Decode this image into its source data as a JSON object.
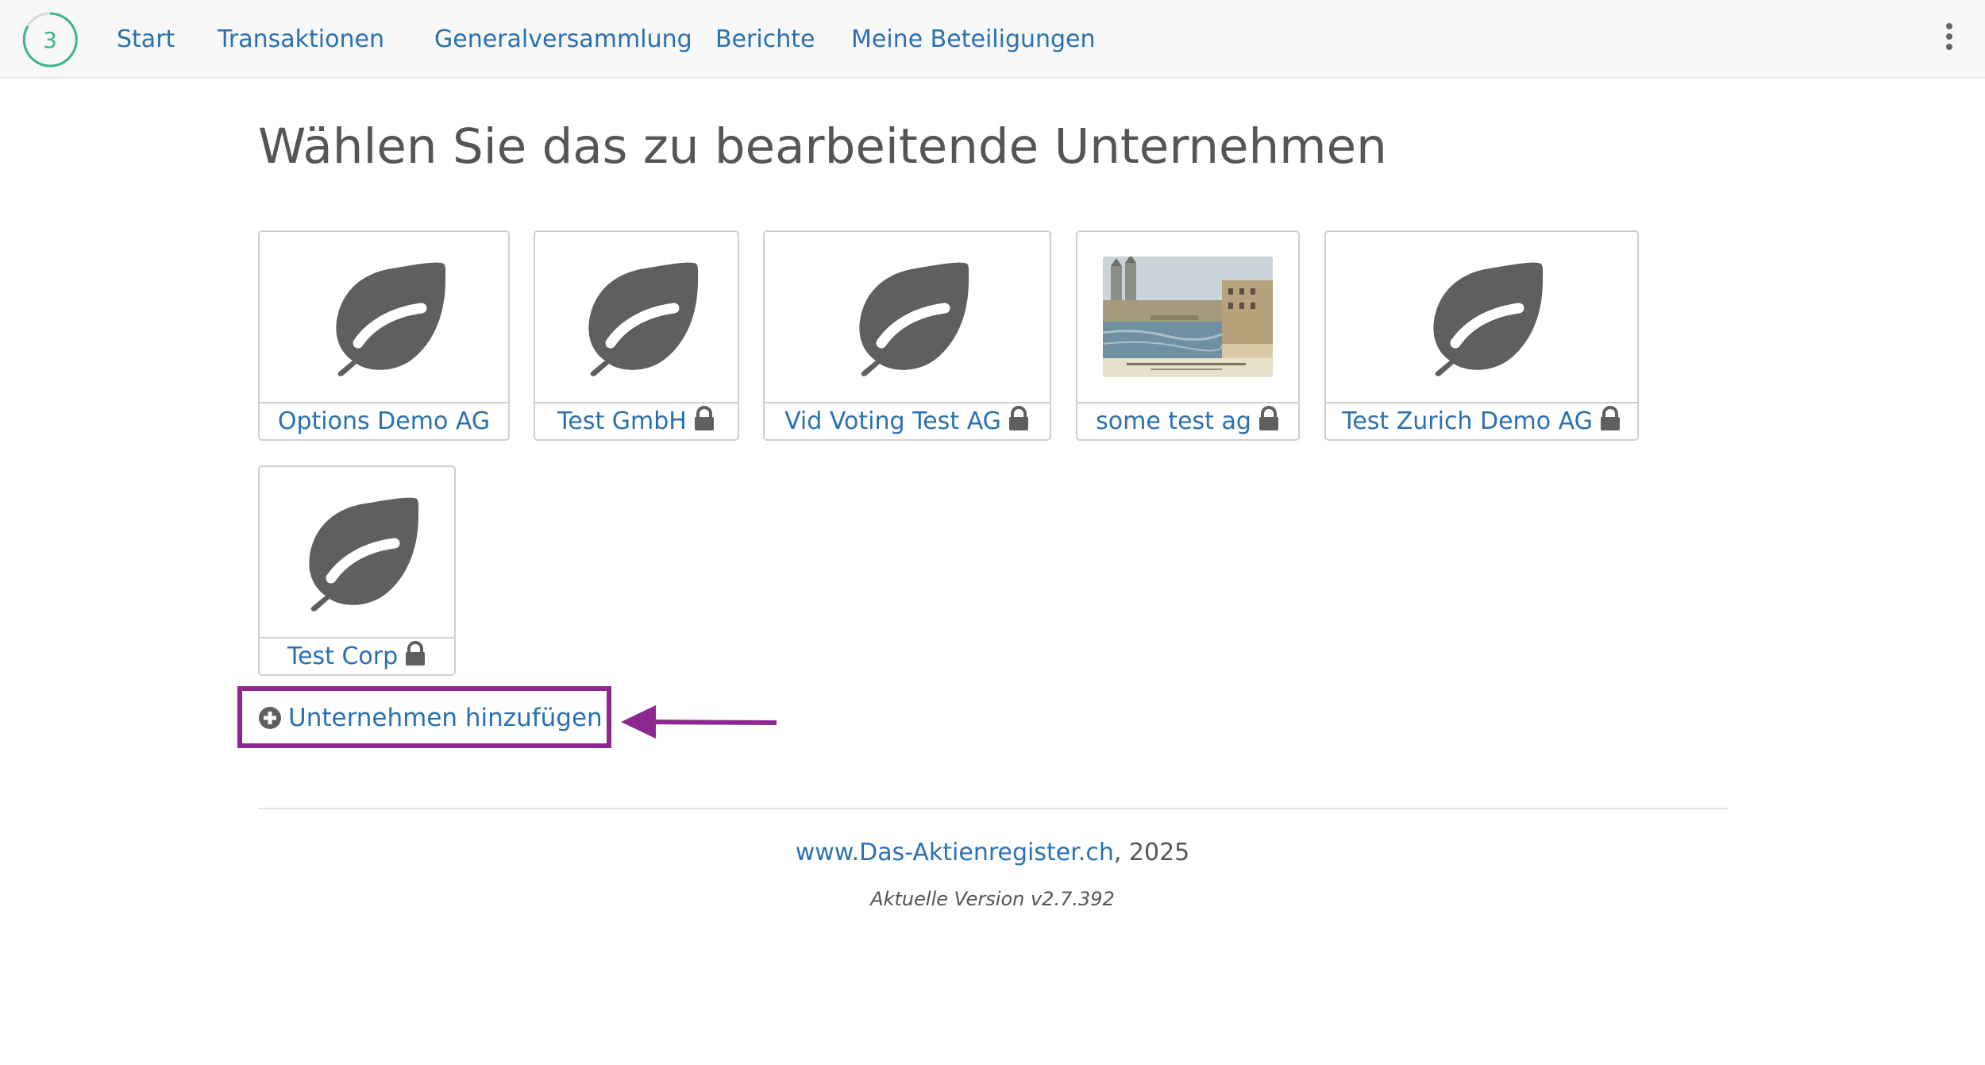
{
  "navbar": {
    "logo_number": "3",
    "items": [
      {
        "label": "Start"
      },
      {
        "label": "Transaktionen"
      },
      {
        "label": "Generalversammlung"
      },
      {
        "label": "Berichte"
      },
      {
        "label": "Meine Beteiligungen"
      }
    ],
    "menu_icon": "vertical-ellipsis-icon"
  },
  "page": {
    "title": "Wählen Sie das zu bearbeitende Unternehmen"
  },
  "companies": [
    {
      "name": "Options Demo AG",
      "locked": false,
      "icon": "leaf-icon"
    },
    {
      "name": "Test GmbH",
      "locked": true,
      "icon": "leaf-icon"
    },
    {
      "name": "Vid Voting Test AG",
      "locked": true,
      "icon": "leaf-icon"
    },
    {
      "name": "some test ag",
      "locked": true,
      "icon": "city-photo"
    },
    {
      "name": "Test Zurich Demo AG",
      "locked": true,
      "icon": "leaf-icon"
    },
    {
      "name": "Test Corp",
      "locked": true,
      "icon": "leaf-icon"
    }
  ],
  "add_company": {
    "label": "Unternehmen hinzufügen",
    "icon": "plus-circle-icon"
  },
  "footer": {
    "site": "www.Das-Aktienregister.ch",
    "year_suffix": ", 2025",
    "version": "Aktuelle Version v2.7.392"
  },
  "colors": {
    "link": "#2a70b0",
    "text": "#555555",
    "icon": "#5f5f5f",
    "highlight": "#8e2891",
    "logo_ring": "#3bb58c"
  }
}
